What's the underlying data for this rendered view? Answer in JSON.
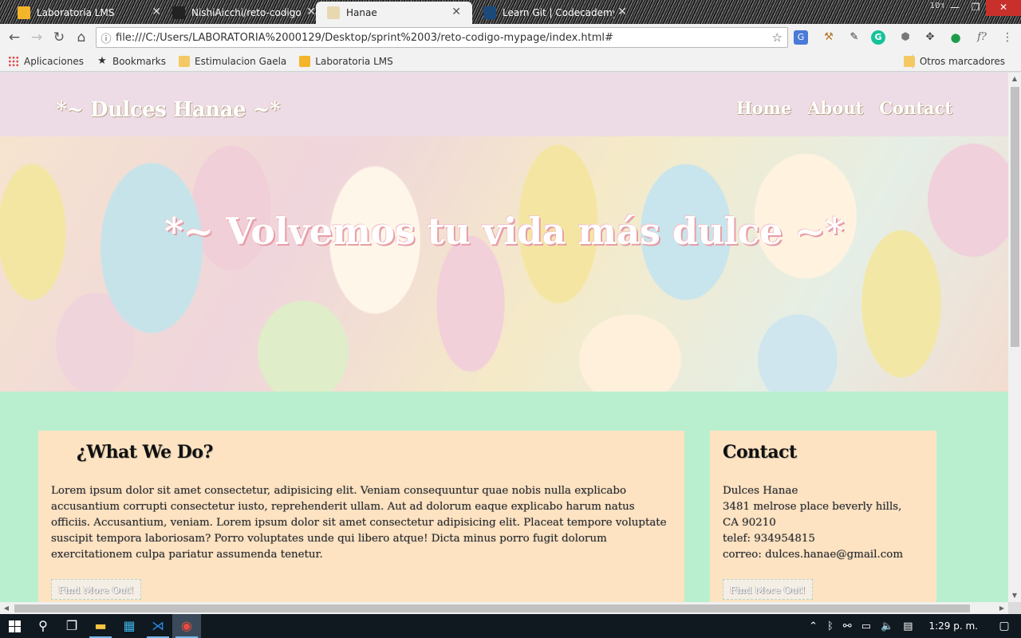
{
  "browser": {
    "tabs": [
      {
        "title": "Laboratoria LMS",
        "favicon": "lms-icon",
        "active": false
      },
      {
        "title": "NishiAicchi/reto-codigo",
        "favicon": "github-icon",
        "active": false
      },
      {
        "title": "Hanae",
        "favicon": "hanae-icon",
        "active": true
      },
      {
        "title": "Learn Git | Codecademy",
        "favicon": "codecademy-icon",
        "active": false
      }
    ],
    "window_user": "ד10",
    "url": "file:///C:/Users/LABORATORIA%2000129/Desktop/sprint%2003/reto-codigo-mypage/index.html#",
    "bookmarks": [
      {
        "label": "Aplicaciones",
        "icon": "apps-grid-icon"
      },
      {
        "label": "Bookmarks",
        "icon": "star-icon"
      },
      {
        "label": "Estimulacion Gaela",
        "icon": "folder-icon"
      },
      {
        "label": "Laboratoria LMS",
        "icon": "lms-icon"
      }
    ],
    "other_bookmarks": "Otros marcadores"
  },
  "site": {
    "logo": "*~ Dulces Hanae ~*",
    "nav": [
      "Home",
      "About",
      "Contact"
    ],
    "hero_title": "*~ Volvemos tu vida más dulce ~*",
    "main_card": {
      "heading": "¿What We Do?",
      "body": "Lorem ipsum dolor sit amet consectetur, adipisicing elit. Veniam consequuntur quae nobis nulla explicabo accusantium corrupti consectetur iusto, reprehenderit ullam. Aut ad dolorum eaque explicabo harum natus officiis. Accusantium, veniam. Lorem ipsum dolor sit amet consectetur adipisicing elit. Placeat tempore voluptate suscipit tempora laboriosam? Porro voluptates unde qui libero atque! Dicta minus porro fugit dolorum exercitationem culpa pariatur assumenda tenetur.",
      "button": "Find More Out!"
    },
    "contact_card": {
      "heading": "Contact",
      "lines": [
        "Dulces Hanae",
        "3481 melrose place beverly hills,",
        "CA 90210",
        "telef: 934954815",
        "correo: dulces.hanae@gmail.com"
      ],
      "button": "Find More Out!"
    },
    "colors": {
      "header_bg": "#eddbe6",
      "page_bg": "#b9efce",
      "card_bg": "#fde3c2"
    }
  },
  "taskbar": {
    "apps": [
      "windows-start-icon",
      "search-icon",
      "task-view-icon",
      "file-explorer-icon",
      "calculator-icon",
      "vscode-icon",
      "chrome-icon"
    ],
    "clock": "1:29 p. m."
  }
}
